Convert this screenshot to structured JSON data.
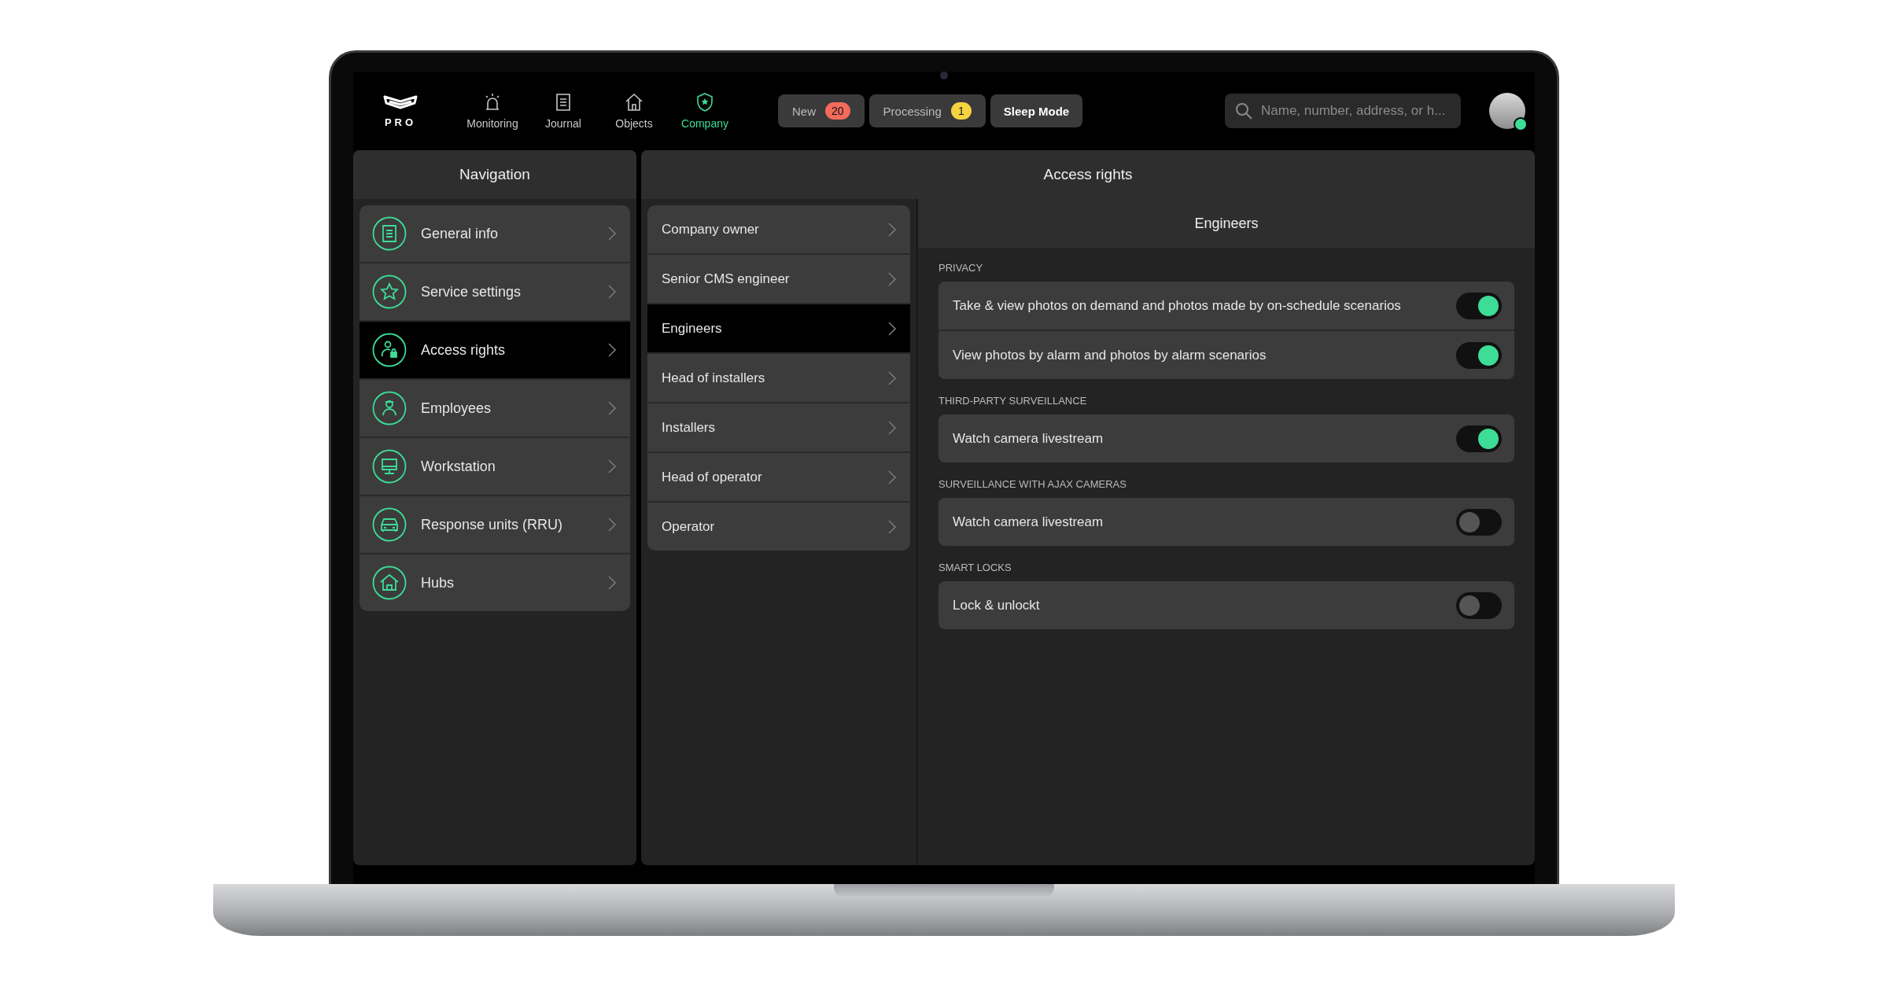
{
  "top_bar": {
    "logo": "PRO",
    "tabs": [
      {
        "label": "Monitoring",
        "selected": false
      },
      {
        "label": "Journal",
        "selected": false
      },
      {
        "label": "Objects",
        "selected": false
      },
      {
        "label": "Company",
        "selected": true
      }
    ],
    "chips": [
      {
        "label": "New",
        "badge": "20",
        "color": "#f26b5b"
      },
      {
        "label": "Processing",
        "badge": "1",
        "color": "#f5d33f"
      },
      {
        "label": "Sleep Mode"
      }
    ],
    "search": {
      "placeholder": "Name, number, address, or h..."
    },
    "user": {
      "online": true
    }
  },
  "navigation": {
    "title": "Navigation",
    "items": [
      {
        "label": "General info",
        "kind": "info",
        "selected": false
      },
      {
        "label": "Service settings",
        "kind": "star",
        "selected": false
      },
      {
        "label": "Access rights",
        "kind": "lock-user",
        "selected": true
      },
      {
        "label": "Employees",
        "kind": "employee",
        "selected": false
      },
      {
        "label": "Workstation",
        "kind": "monitor",
        "selected": false
      },
      {
        "label": "Response units (RRU)",
        "kind": "car",
        "selected": false
      },
      {
        "label": "Hubs",
        "kind": "house",
        "selected": false
      }
    ]
  },
  "access_rights": {
    "title": "Access rights",
    "roles": [
      {
        "label": "Company owner",
        "selected": false
      },
      {
        "label": "Senior CMS engineer",
        "selected": false
      },
      {
        "label": "Engineers",
        "selected": true
      },
      {
        "label": "Head of installers",
        "selected": false
      },
      {
        "label": "Installers",
        "selected": false
      },
      {
        "label": "Head of operator",
        "selected": false
      },
      {
        "label": "Operator",
        "selected": false
      }
    ],
    "detail": {
      "title": "Engineers",
      "sections": [
        {
          "heading": "PRIVACY",
          "permissions": [
            {
              "label": "Take & view photos on demand and photos made by on-schedule scenarios",
              "on": true
            },
            {
              "label": "View photos by alarm and photos by alarm scenarios",
              "on": true
            }
          ]
        },
        {
          "heading": "THIRD-PARTY SURVEILLANCE",
          "permissions": [
            {
              "label": "Watch camera livestream",
              "on": true
            }
          ]
        },
        {
          "heading": "SURVEILLANCE WITH AJAX CAMERAS",
          "permissions": [
            {
              "label": "Watch camera livestream",
              "on": false
            }
          ]
        },
        {
          "heading": "SMART LOCKS",
          "permissions": [
            {
              "label": "Lock & unlockt",
              "on": false
            }
          ]
        }
      ]
    }
  }
}
